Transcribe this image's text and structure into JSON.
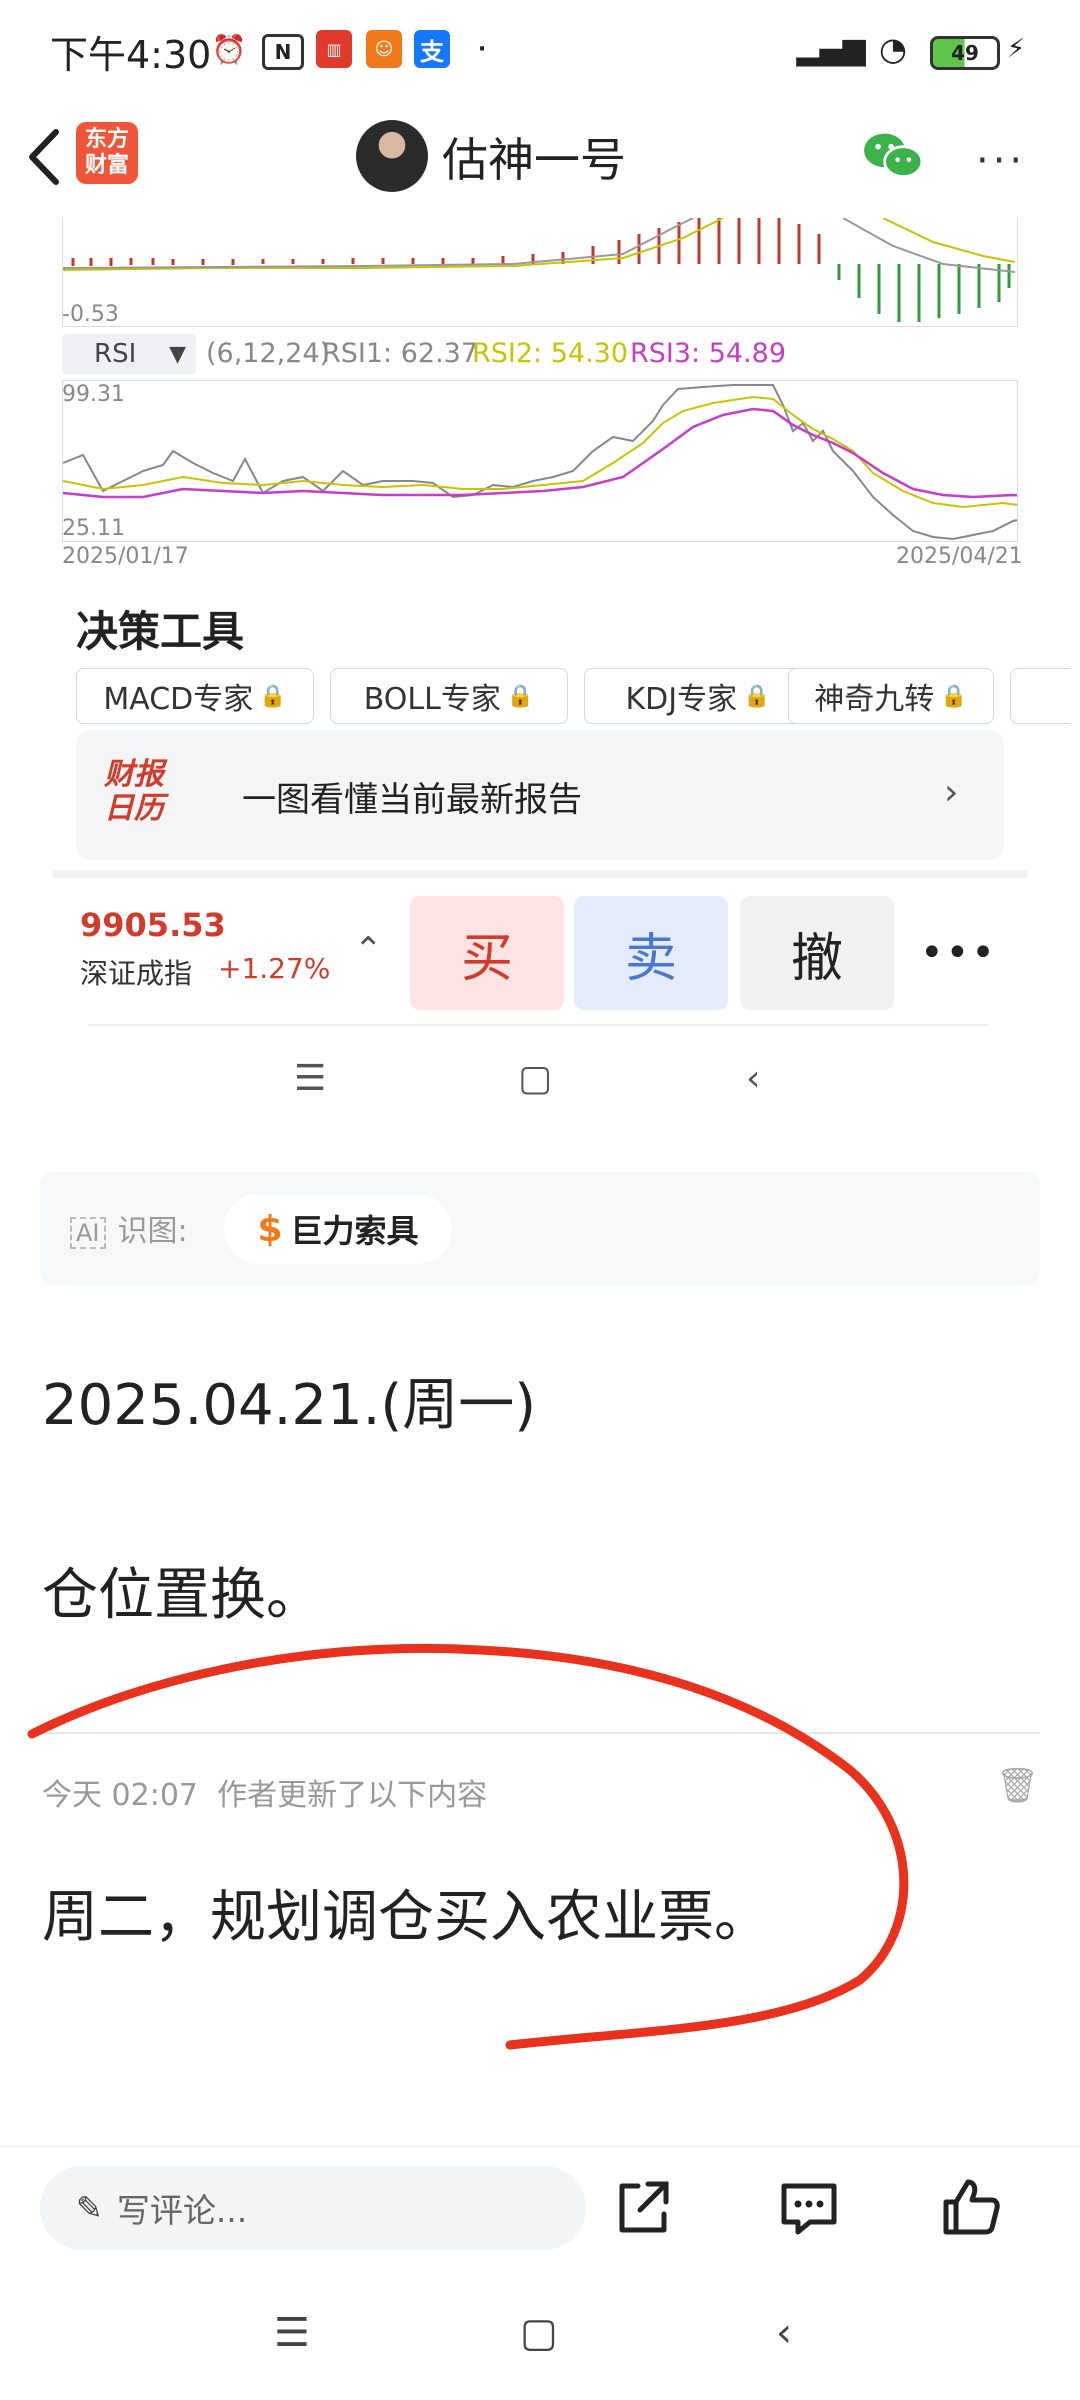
{
  "status_bar": {
    "time": "下午4:30",
    "battery": "49"
  },
  "header": {
    "logo_text_1": "东方",
    "logo_text_2": "财富",
    "title": "估神一号"
  },
  "chart": {
    "macd_min_label": "-0.53",
    "rsi_indicator": "RSI",
    "rsi_params": "(6,12,24)",
    "rsi1": "RSI1: 62.37",
    "rsi2": "RSI2: 54.30",
    "rsi3": "RSI3: 54.89",
    "rsi_max_label": "99.31",
    "rsi_min_label": "25.11",
    "date_start": "2025/01/17",
    "date_end": "2025/04/21"
  },
  "decision_tools": {
    "title": "决策工具",
    "tools": [
      "MACD专家",
      "BOLL专家",
      "KDJ专家",
      "神奇九转"
    ],
    "report_logo_1": "财报",
    "report_logo_2": "日历",
    "report_text": "一图看懂当前最新报告"
  },
  "quote": {
    "price": "9905.53",
    "index_name": "深证成指",
    "change": "+1.27%",
    "buy_label": "买",
    "sell_label": "卖",
    "cancel_label": "撤"
  },
  "ai_tag": {
    "label": "识图:",
    "chip": "巨力索具"
  },
  "content": {
    "date_line": "2025.04.21.(周一)",
    "line1": "仓位置换。",
    "meta": "今天 02:07  作者更新了以下内容",
    "line2": "周二，规划调仓买入农业票。"
  },
  "bottom_bar": {
    "comment_placeholder": "写评论..."
  },
  "colors": {
    "accent_red": "#d23a2a",
    "annotation_red": "#e8321e",
    "rsi1_color": "#888888",
    "rsi2_color": "#c9c300",
    "rsi3_color": "#c83cc8"
  }
}
